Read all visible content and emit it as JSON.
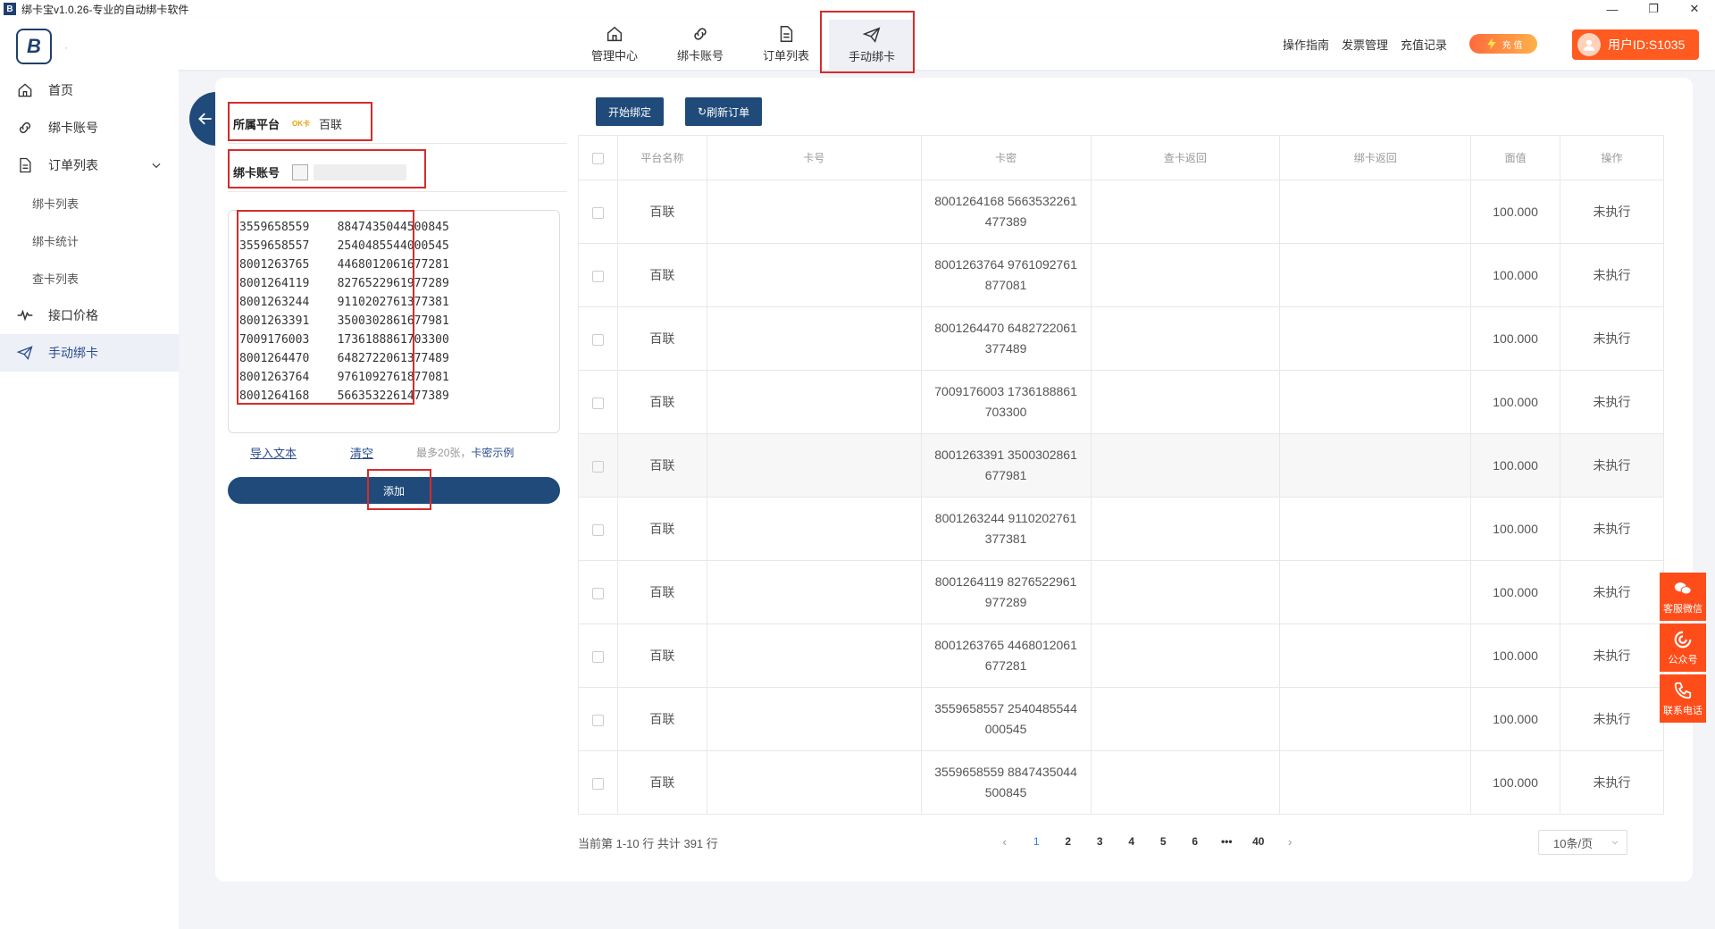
{
  "window": {
    "title": "绑卡宝v1.0.26-专业的自动绑卡软件",
    "app_icon_letter": "B",
    "minimize": "—",
    "restore": "❐",
    "close": "✕"
  },
  "header": {
    "logo_letter": "B",
    "logo_dot": "·",
    "nav": [
      {
        "label": "管理中心",
        "icon": "home-icon"
      },
      {
        "label": "绑卡账号",
        "icon": "link-icon"
      },
      {
        "label": "订单列表",
        "icon": "document-icon"
      },
      {
        "label": "手动绑卡",
        "icon": "send-icon",
        "active": true
      }
    ],
    "links": [
      "操作指南",
      "发票管理",
      "充值记录"
    ],
    "recharge_label": "充 值",
    "user_label": "用户ID:S1035"
  },
  "sidebar": {
    "items": [
      {
        "label": "首页",
        "icon": "home-icon"
      },
      {
        "label": "绑卡账号",
        "icon": "link-icon"
      },
      {
        "label": "订单列表",
        "icon": "document-icon",
        "expanded": true
      },
      {
        "label": "绑卡列表",
        "sub": true
      },
      {
        "label": "绑卡统计",
        "sub": true
      },
      {
        "label": "查卡列表",
        "sub": true
      },
      {
        "label": "接口价格",
        "icon": "pulse-icon"
      },
      {
        "label": "手动绑卡",
        "icon": "send-icon",
        "active": true
      }
    ]
  },
  "form": {
    "platform_label": "所属平台",
    "platform_logo_text": "OK卡",
    "platform_value": "百联",
    "account_label": "绑卡账号",
    "card_lines": [
      "3559658559    8847435044500845",
      "3559658557    2540485544000545",
      "8001263765    4468012061677281",
      "8001264119    8276522961977289",
      "8001263244    9110202761377381",
      "8001263391    3500302861677981",
      "7009176003    1736188861703300",
      "8001264470    6482722061377489",
      "8001263764    9761092761877081",
      "8001264168    5663532261477389"
    ],
    "import_label": "导入文本",
    "clear_label": "清空",
    "hint": "最多20张，",
    "example_label": "卡密示例",
    "add_label": "添加"
  },
  "toolbar": {
    "start_label": "开始绑定",
    "refresh_label": "刷新订单",
    "refresh_icon": "↻"
  },
  "table": {
    "headers": [
      "平台名称",
      "卡号",
      "卡密",
      "查卡返回",
      "绑卡返回",
      "面值",
      "操作"
    ],
    "rows": [
      {
        "platform": "百联",
        "card": "",
        "pass1": "8001264168 5663532261",
        "pass2": "477389",
        "query": "",
        "bind": "",
        "value": "100.000",
        "op": "未执行"
      },
      {
        "platform": "百联",
        "card": "",
        "pass1": "8001263764 9761092761",
        "pass2": "877081",
        "query": "",
        "bind": "",
        "value": "100.000",
        "op": "未执行"
      },
      {
        "platform": "百联",
        "card": "",
        "pass1": "8001264470 6482722061",
        "pass2": "377489",
        "query": "",
        "bind": "",
        "value": "100.000",
        "op": "未执行"
      },
      {
        "platform": "百联",
        "card": "",
        "pass1": "7009176003 1736188861",
        "pass2": "703300",
        "query": "",
        "bind": "",
        "value": "100.000",
        "op": "未执行"
      },
      {
        "platform": "百联",
        "card": "",
        "pass1": "8001263391 3500302861",
        "pass2": "677981",
        "query": "",
        "bind": "",
        "value": "100.000",
        "op": "未执行"
      },
      {
        "platform": "百联",
        "card": "",
        "pass1": "8001263244 9110202761",
        "pass2": "377381",
        "query": "",
        "bind": "",
        "value": "100.000",
        "op": "未执行"
      },
      {
        "platform": "百联",
        "card": "",
        "pass1": "8001264119 8276522961",
        "pass2": "977289",
        "query": "",
        "bind": "",
        "value": "100.000",
        "op": "未执行"
      },
      {
        "platform": "百联",
        "card": "",
        "pass1": "8001263765 4468012061",
        "pass2": "677281",
        "query": "",
        "bind": "",
        "value": "100.000",
        "op": "未执行"
      },
      {
        "platform": "百联",
        "card": "",
        "pass1": "3559658557 2540485544",
        "pass2": "000545",
        "query": "",
        "bind": "",
        "value": "100.000",
        "op": "未执行"
      },
      {
        "platform": "百联",
        "card": "",
        "pass1": "3559658559 8847435044",
        "pass2": "500845",
        "query": "",
        "bind": "",
        "value": "100.000",
        "op": "未执行"
      }
    ]
  },
  "pager": {
    "total_text": "当前第 1-10 行  共计 391 行",
    "prev": "‹",
    "next": "›",
    "pages": [
      "1",
      "2",
      "3",
      "4",
      "5",
      "6",
      "•••",
      "40"
    ],
    "current": "1",
    "page_size": "10条/页"
  },
  "float": {
    "wechat": "客服微信",
    "official": "公众号",
    "phone": "联系电话"
  },
  "colors": {
    "primary": "#1f4a7a",
    "accent": "#ff5a1f",
    "highlight_box": "#d72b2b",
    "page_link": "#2a7de1"
  }
}
